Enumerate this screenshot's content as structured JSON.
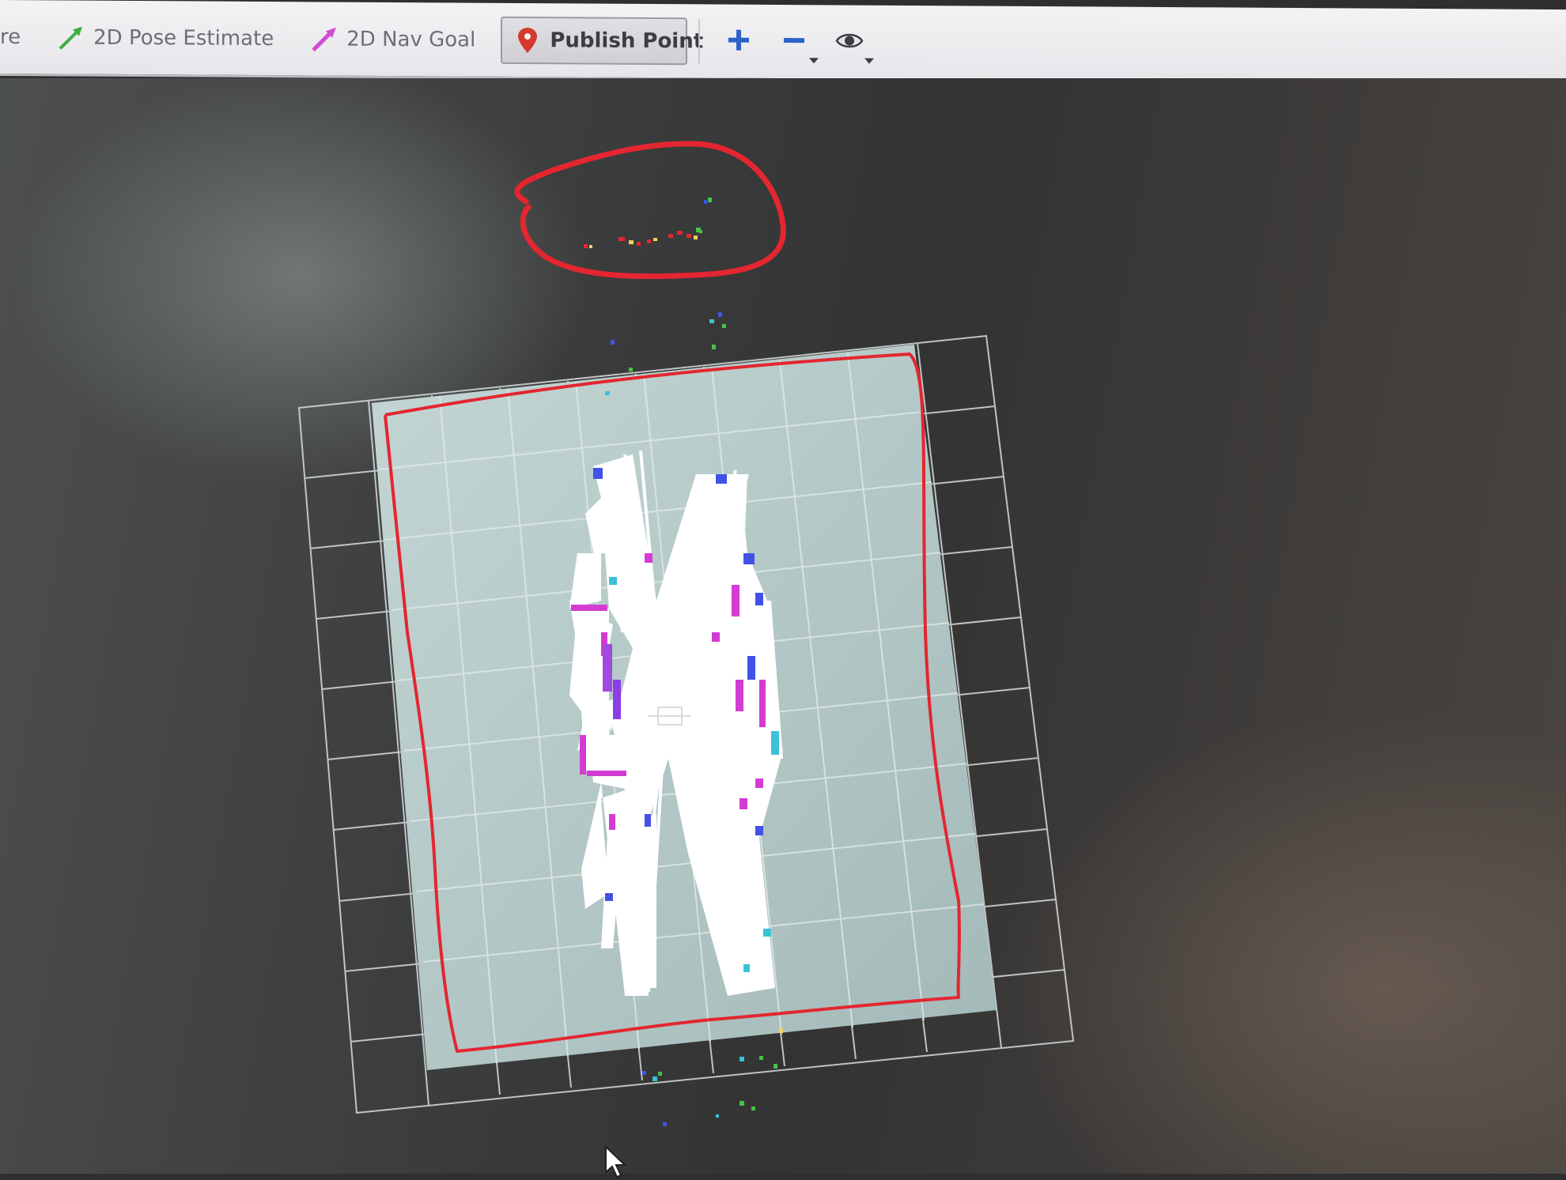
{
  "toolbar": {
    "cut_off_tool_label": "re",
    "pose_estimate_label": "2D Pose Estimate",
    "nav_goal_label": "2D Nav Goal",
    "publish_point_label": "Publish Point",
    "active_tool": "Publish Point",
    "icons": [
      "pose-estimate-arrow-icon",
      "nav-goal-arrow-icon",
      "location-pin-icon",
      "zoom-in-icon",
      "zoom-out-icon",
      "eye-icon"
    ]
  },
  "colors": {
    "toolbar_bg": "#ececf0",
    "map_free": "#ffffff",
    "map_unknown": "#b7cccb",
    "grid_line": "#d8dcdc",
    "annotation_red": "#e32630",
    "pose_arrow": "#3fae3f",
    "goal_arrow": "#d24bd2",
    "pin_red": "#d63a2e",
    "zoom_blue": "#2b63c7"
  }
}
